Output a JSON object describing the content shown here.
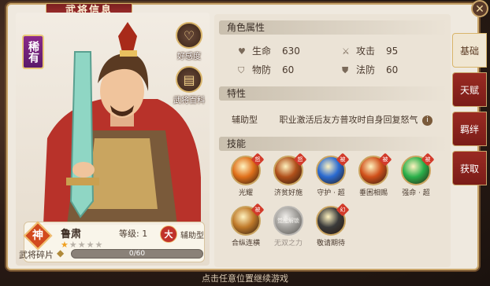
{
  "header": {
    "title": "武将信息"
  },
  "portrait": {
    "rarity": "稀有",
    "favor_label": "好感度",
    "encyclopedia_label": "武将百科",
    "card": {
      "faction": "神",
      "name": "鲁肃",
      "level_text": "等级: 1",
      "stars_total": 5,
      "stars_filled": 1,
      "type_badge": "大",
      "type_label": "辅助型"
    },
    "fragments": {
      "label": "武将碎片",
      "progress_text": "0/60",
      "progress": 0
    }
  },
  "attributes": {
    "title": "角色属性",
    "stats": [
      {
        "icon": "heart-icon",
        "label": "生命",
        "value": "630"
      },
      {
        "icon": "sword-icon",
        "label": "攻击",
        "value": "95"
      },
      {
        "icon": "shield-icon",
        "label": "物防",
        "value": "60"
      },
      {
        "icon": "magic-shield-icon",
        "label": "法防",
        "value": "60"
      }
    ]
  },
  "traits": {
    "title": "特性",
    "type": "辅助型",
    "description": "职业激活后友方普攻时自身回复怒气"
  },
  "skills": {
    "title": "技能",
    "items": [
      {
        "name": "光耀",
        "tag": "怒",
        "color": "#e0701a",
        "enabled": true
      },
      {
        "name": "济贫好施",
        "tag": "怒",
        "color": "#b0501a",
        "enabled": true
      },
      {
        "name": "守护 · 超",
        "tag": "被",
        "color": "#2a6ad0",
        "enabled": true
      },
      {
        "name": "垂困相赐",
        "tag": "被",
        "color": "#d0501a",
        "enabled": true
      },
      {
        "name": "强命 · 超",
        "tag": "被",
        "color": "#2ab04a",
        "enabled": true
      },
      {
        "name": "合纵连横",
        "tag": "被",
        "color": "#c07a2a",
        "enabled": true
      },
      {
        "name": "无双之力",
        "tag": "",
        "color": "#888888",
        "enabled": false,
        "badge": "觉醒解锁"
      },
      {
        "name": "敬请期待",
        "tag": "幻",
        "color": "#3a3a3a",
        "enabled": true
      }
    ]
  },
  "tabs": [
    "基础",
    "天赋",
    "羁绊",
    "获取"
  ],
  "active_tab": "基础",
  "footer_hint": "点击任意位置继续游戏"
}
